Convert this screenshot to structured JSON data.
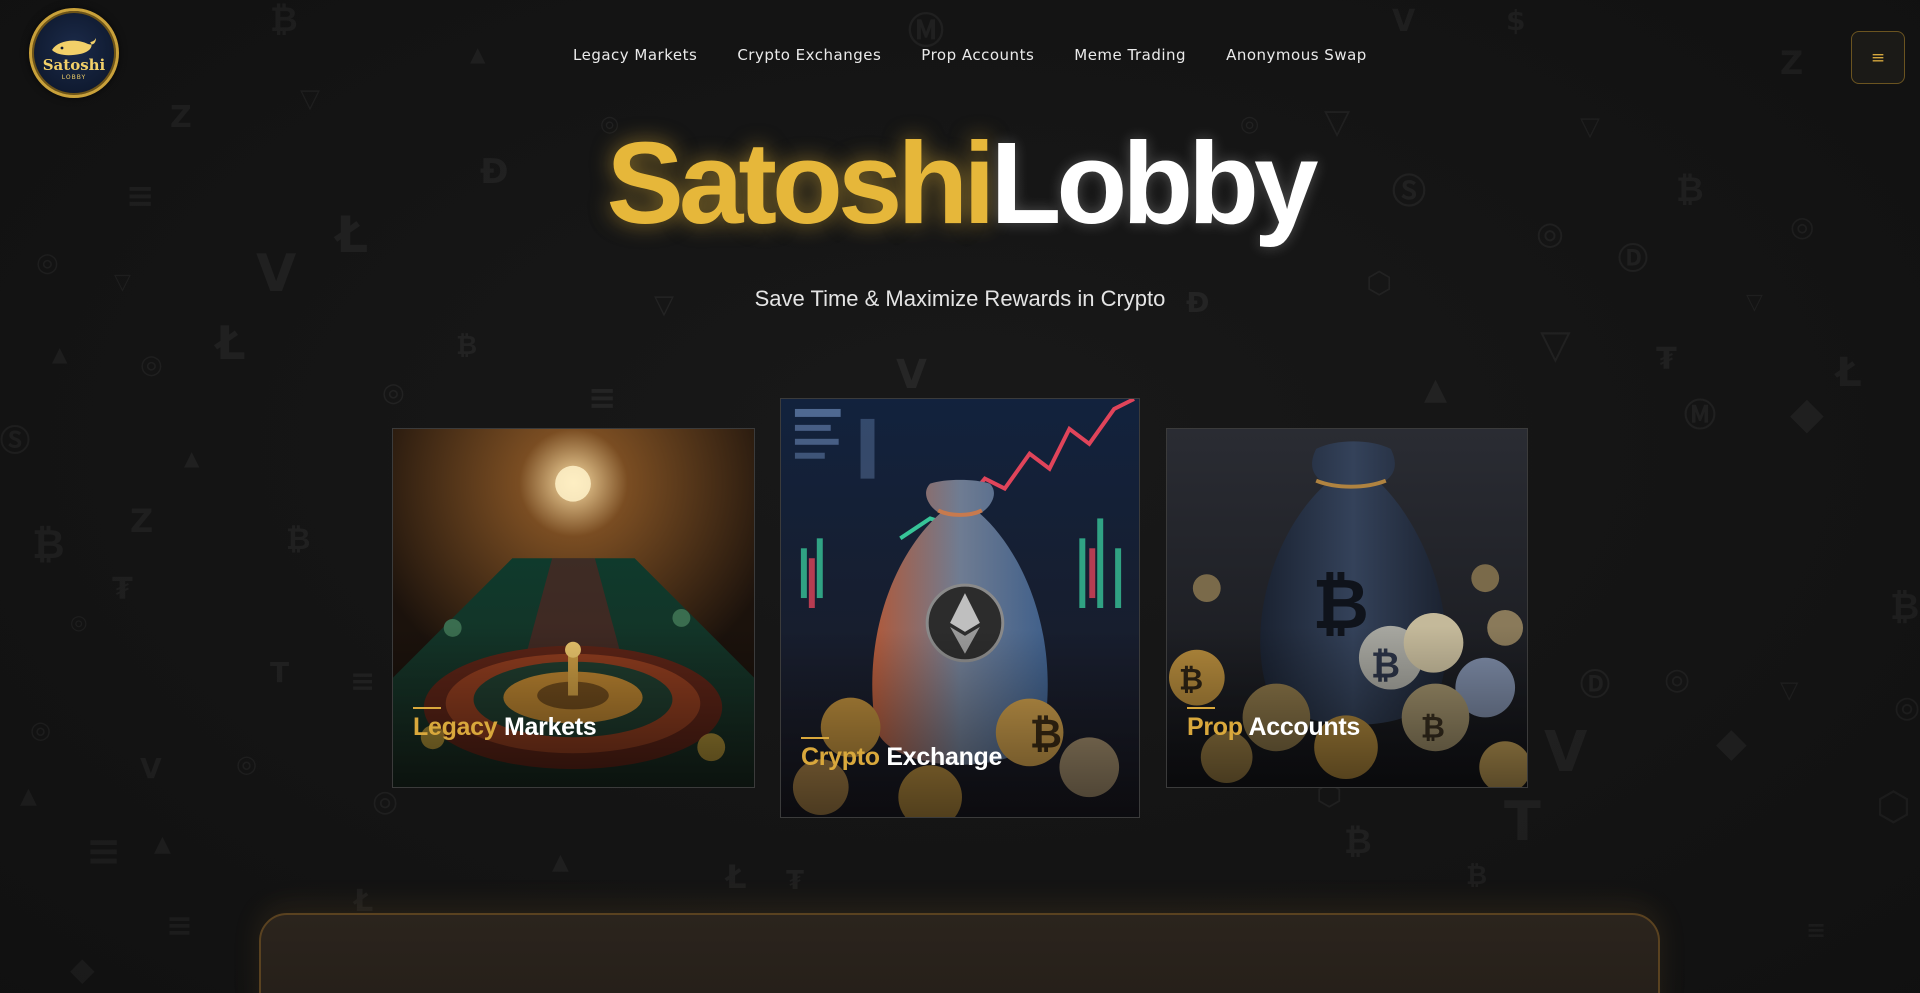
{
  "logo": {
    "title": "Satoshi",
    "subtitle": "LOBBY"
  },
  "nav": {
    "items": [
      {
        "label": "Legacy Markets"
      },
      {
        "label": "Crypto Exchanges"
      },
      {
        "label": "Prop Accounts"
      },
      {
        "label": "Meme Trading"
      },
      {
        "label": "Anonymous Swap"
      }
    ],
    "menu_icon": "≡"
  },
  "hero": {
    "title_gold": "Satoshi",
    "title_white": "Lobby",
    "tagline": "Save Time & Maximize Rewards in Crypto"
  },
  "cards": [
    {
      "label_gold": "Legacy",
      "label_white": "Markets",
      "image": "casino-roulette"
    },
    {
      "label_gold": "Crypto",
      "label_white": "Exchange",
      "image": "ethereum-bag-chart"
    },
    {
      "label_gold": "Prop",
      "label_white": "Accounts",
      "image": "bitcoin-bag-coins"
    }
  ],
  "colors": {
    "background": "#161616",
    "accent_gold": "#e6b73a",
    "card_label_gold": "#d9a83c",
    "panel_border": "#5a4220"
  }
}
